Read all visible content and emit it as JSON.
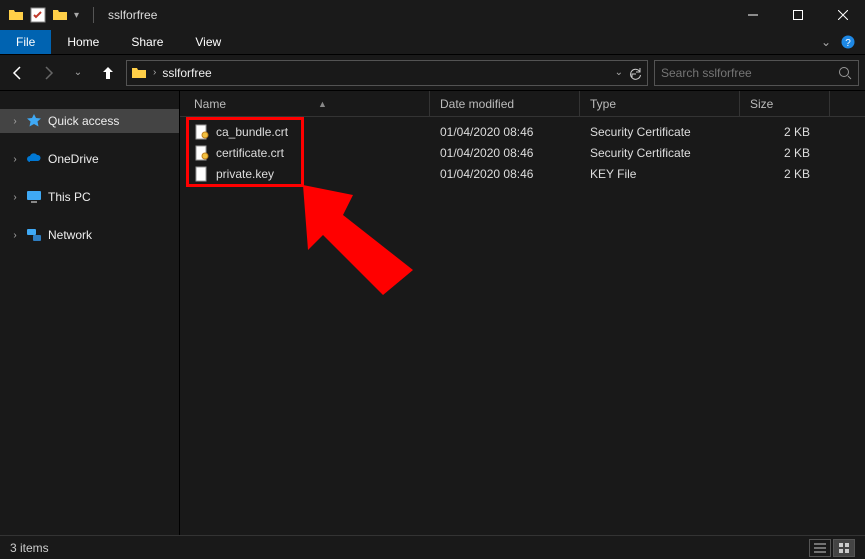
{
  "window": {
    "title": "sslforfree"
  },
  "ribbon": {
    "file": "File",
    "tabs": [
      "Home",
      "Share",
      "View"
    ]
  },
  "address": {
    "crumb": "sslforfree",
    "search_placeholder": "Search sslforfree"
  },
  "sidebar": {
    "quick_access": "Quick access",
    "onedrive": "OneDrive",
    "this_pc": "This PC",
    "network": "Network"
  },
  "columns": {
    "name": "Name",
    "date": "Date modified",
    "type": "Type",
    "size": "Size"
  },
  "files": [
    {
      "name": "ca_bundle.crt",
      "date": "01/04/2020 08:46",
      "type": "Security Certificate",
      "size": "2 KB",
      "icon": "cert"
    },
    {
      "name": "certificate.crt",
      "date": "01/04/2020 08:46",
      "type": "Security Certificate",
      "size": "2 KB",
      "icon": "cert"
    },
    {
      "name": "private.key",
      "date": "01/04/2020 08:46",
      "type": "KEY File",
      "size": "2 KB",
      "icon": "file"
    }
  ],
  "status": {
    "items": "3 items"
  }
}
